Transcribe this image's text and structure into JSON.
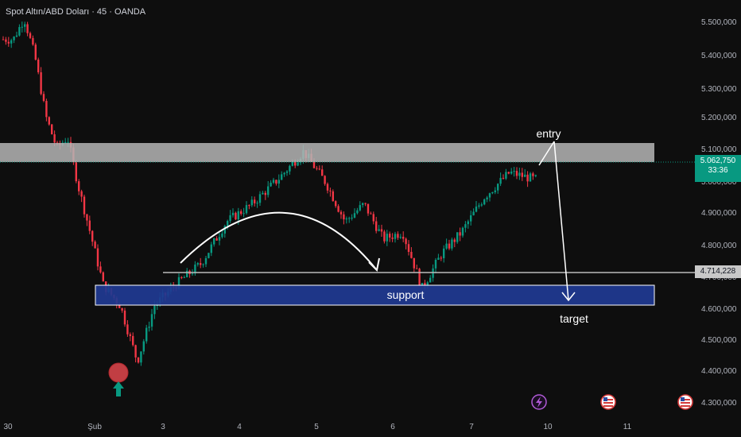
{
  "header": {
    "title": "Spot Altın/ABD Doları · 45 · OANDA"
  },
  "price_tags": {
    "current_price": "5.062,750",
    "countdown": "33:36",
    "level_price": "4.714,228"
  },
  "annotations": {
    "entry": "entry",
    "support": "support",
    "target": "target"
  },
  "colors": {
    "background": "#0e0e0e",
    "bull": "#089981",
    "bear": "#f23645",
    "zone_gray": "#b5b5b5",
    "support_blue": "#1f3a93",
    "marker_red": "#e0474c",
    "arrow_green": "#089981"
  },
  "event_icons": [
    "lightning-icon",
    "us-flag-icon",
    "us-flag-icon"
  ],
  "chart_data": {
    "type": "candlestick",
    "y_axis_ticks": [
      "5.500,000",
      "5.400,000",
      "5.300,000",
      "5.200,000",
      "5.100,000",
      "5.000,000",
      "4.900,000",
      "4.800,000",
      "4.700,000",
      "4.600,000",
      "4.500,000",
      "4.400,000",
      "4.300,000"
    ],
    "x_axis_ticks": [
      "30",
      "Şub",
      "3",
      "4",
      "5",
      "6",
      "7",
      "10",
      "11"
    ],
    "ylim": [
      4270000,
      5540000
    ],
    "resistance_zone": [
      5040000,
      5140000
    ],
    "support_zone": [
      4610000,
      4680000
    ],
    "horizontal_level": 4714228,
    "current_price": 5062750,
    "close_path": [
      {
        "x": "30",
        "y": 5400000
      },
      {
        "x": "30",
        "y": 5460000
      },
      {
        "x": "30",
        "y": 5350000
      },
      {
        "x": "30",
        "y": 5180000
      },
      {
        "x": "30",
        "y": 5090000
      },
      {
        "x": "30",
        "y": 5120000
      },
      {
        "x": "30",
        "y": 4980000
      },
      {
        "x": "30",
        "y": 4860000
      },
      {
        "x": "Şub",
        "y": 4700000
      },
      {
        "x": "Şub",
        "y": 4640000
      },
      {
        "x": "Şub",
        "y": 4480000
      },
      {
        "x": "Şub",
        "y": 4640000
      },
      {
        "x": "3",
        "y": 4700000
      },
      {
        "x": "3",
        "y": 4760000
      },
      {
        "x": "3",
        "y": 4880000
      },
      {
        "x": "4",
        "y": 4930000
      },
      {
        "x": "4",
        "y": 5000000
      },
      {
        "x": "4",
        "y": 5080000
      },
      {
        "x": "5",
        "y": 4990000
      },
      {
        "x": "5",
        "y": 4880000
      },
      {
        "x": "5",
        "y": 4930000
      },
      {
        "x": "5",
        "y": 4830000
      },
      {
        "x": "6",
        "y": 4850000
      },
      {
        "x": "6",
        "y": 4690000
      },
      {
        "x": "6",
        "y": 4790000
      },
      {
        "x": "6",
        "y": 4850000
      },
      {
        "x": "7",
        "y": 4950000
      },
      {
        "x": "7",
        "y": 5020000
      },
      {
        "x": "7",
        "y": 5000000
      },
      {
        "x": "10",
        "y": 5062750
      }
    ]
  }
}
